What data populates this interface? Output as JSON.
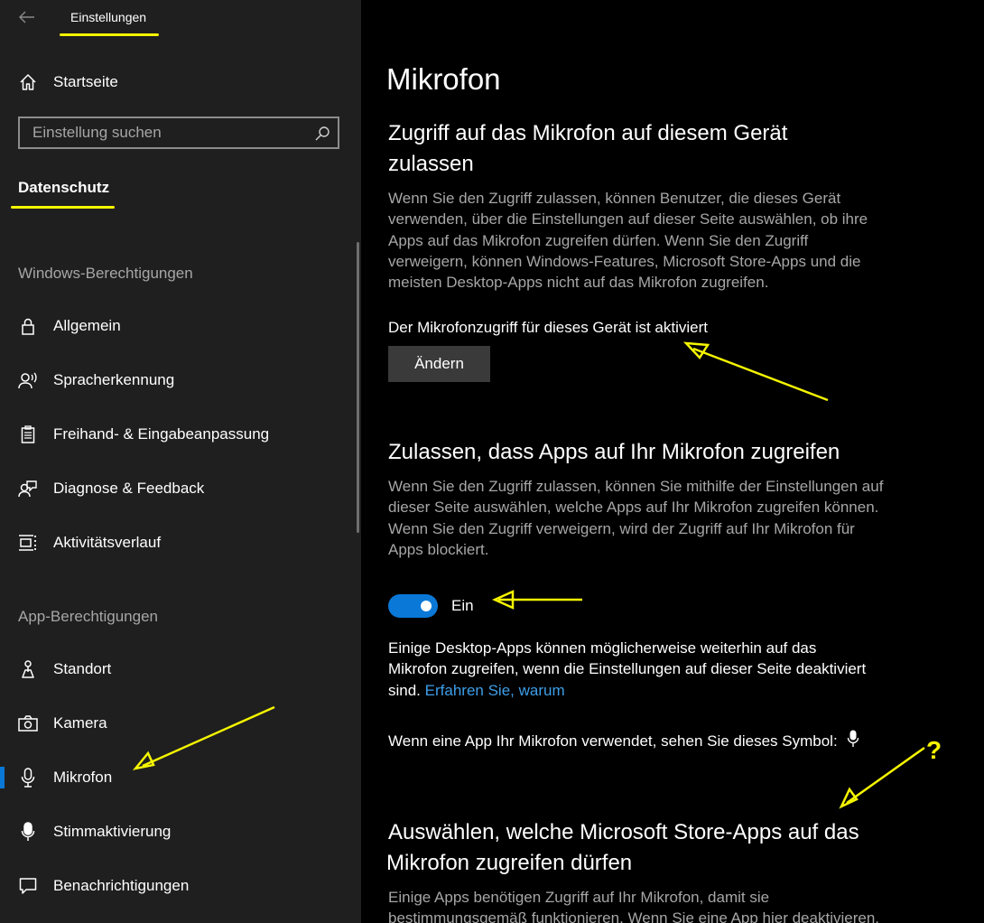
{
  "titlebar": {
    "title": "Einstellungen",
    "back_icon": "arrow-left-icon"
  },
  "sidebar": {
    "home_label": "Startseite",
    "search_placeholder": "Einstellung suchen",
    "group_title": "Datenschutz",
    "sections": [
      {
        "heading": "Windows-Berechtigungen",
        "items": [
          {
            "label": "Allgemein",
            "icon": "lock-icon"
          },
          {
            "label": "Spracherkennung",
            "icon": "speech-icon"
          },
          {
            "label": "Freihand- & Eingabeanpassung",
            "icon": "clipboard-icon"
          },
          {
            "label": "Diagnose & Feedback",
            "icon": "feedback-icon"
          },
          {
            "label": "Aktivitätsverlauf",
            "icon": "timeline-icon"
          }
        ]
      },
      {
        "heading": "App-Berechtigungen",
        "items": [
          {
            "label": "Standort",
            "icon": "location-icon"
          },
          {
            "label": "Kamera",
            "icon": "camera-icon"
          },
          {
            "label": "Mikrofon",
            "icon": "microphone-icon",
            "selected": true
          },
          {
            "label": "Stimmaktivierung",
            "icon": "voice-activation-icon"
          },
          {
            "label": "Benachrichtigungen",
            "icon": "notification-icon"
          }
        ]
      }
    ]
  },
  "main": {
    "title": "Mikrofon",
    "device_section": {
      "heading_line1": "Zugriff auf das Mikrofon auf diesem Gerät",
      "heading_line2": "zulassen",
      "description_lines": [
        "Wenn Sie den Zugriff zulassen, können Benutzer, die dieses Gerät",
        "verwenden, über die Einstellungen auf dieser Seite auswählen, ob ihre",
        "Apps auf das Mikrofon zugreifen dürfen. Wenn Sie den Zugriff",
        "verweigern, können Windows-Features, Microsoft Store-Apps und die",
        "meisten Desktop-Apps nicht auf das Mikrofon zugreifen."
      ],
      "status": "Der Mikrofonzugriff für dieses Gerät ist aktiviert",
      "change_button": "Ändern"
    },
    "apps_section": {
      "heading": "Zulassen, dass Apps auf Ihr Mikrofon zugreifen",
      "description_lines": [
        "Wenn Sie den Zugriff zulassen, können Sie mithilfe der Einstellungen auf",
        "dieser Seite auswählen, welche Apps auf Ihr Mikrofon zugreifen können.",
        "Wenn Sie den Zugriff verweigern, wird der Zugriff auf Ihr Mikrofon für",
        "Apps blockiert."
      ],
      "toggle_on": true,
      "toggle_label": "Ein",
      "desktop_note_lines": [
        "Einige Desktop-Apps können möglicherweise weiterhin auf das",
        "Mikrofon zugreifen, wenn die Einstellungen auf dieser Seite deaktiviert",
        "sind."
      ],
      "learn_more_link": "Erfahren Sie, warum",
      "symbol_note": "Wenn eine App Ihr Mikrofon verwendet, sehen Sie dieses Symbol:"
    },
    "store_section": {
      "heading_line1": "Auswählen, welche Microsoft Store-Apps auf das",
      "heading_line2": "Mikrofon zugreifen dürfen",
      "description_lines": [
        "Einige Apps benötigen Zugriff auf Ihr Mikrofon, damit sie",
        "bestimmungsgemäß funktionieren. Wenn Sie eine App hier deaktivieren,"
      ]
    }
  },
  "annotations": {
    "question_mark": "?",
    "color": "#f5f500"
  },
  "colors": {
    "sidebar_bg": "#1f1f1f",
    "main_bg": "#000000",
    "accent": "#0a78d7",
    "link": "#3d9ee8",
    "secondary_text": "#a6a6a6"
  }
}
